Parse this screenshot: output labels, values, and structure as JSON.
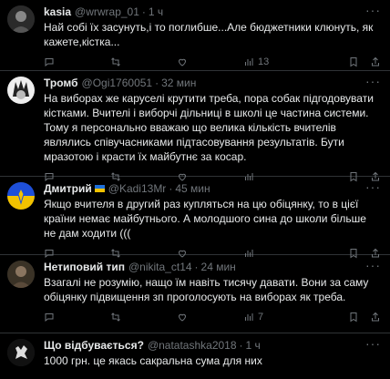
{
  "tweets": [
    {
      "name": "kasia",
      "handle": "@wrwrap_01",
      "time": "1 ч",
      "text": "Най собі їх засунуть,і то поглибше...Але бюджетники клюнуть, як кажете,кістка...",
      "views": "13"
    },
    {
      "name": "Тромб",
      "handle": "@Ogi1760051",
      "time": "32 мин",
      "text": "На виборах же каруселі крутити треба, пора собак підгодовувати кістками. Вчителі і виборчі дільниці в школі це частина системи. Тому я персонально вважаю що велика кількість вчителів являлись співучасниками підтасовування результатів. Бути мразотою і красти їх майбутнє за косар.",
      "views": ""
    },
    {
      "name": "Дмитрий",
      "handle": "@Kadi13Mr",
      "time": "45 мин",
      "text": "Якщо вчителя в другий раз купляться на цю обіцянку, то в цієї країни немає майбутнього. А молодшого сина до школи більше не дам ходити (((",
      "views": ""
    },
    {
      "name": "Нетиповий тип",
      "handle": "@nikita_ct14",
      "time": "24 мин",
      "text": "Взагалі не розумію, нащо їм навіть тисячу давати. Вони за саму обіцянку підвищення зп проголосують на виборах як треба.",
      "views": "7"
    },
    {
      "name": "Що відбувається?",
      "handle": "@natatashka2018",
      "time": "1 ч",
      "text": "1000 грн. це якась сакральна сума для них",
      "views": ""
    }
  ]
}
